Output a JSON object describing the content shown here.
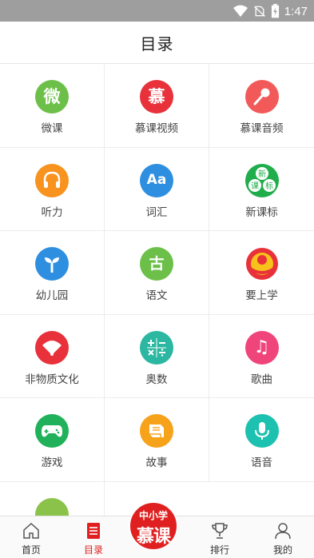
{
  "status_bar": {
    "time": "1:47",
    "icons": [
      "wifi-icon",
      "no-sim-icon",
      "battery-charging-icon"
    ]
  },
  "header": {
    "title": "目录"
  },
  "grid": {
    "items": [
      {
        "label": "微课",
        "icon": "wei-icon",
        "glyph": "微",
        "color": "#6cc04a"
      },
      {
        "label": "慕课视频",
        "icon": "mu-icon",
        "glyph": "慕",
        "color": "#e8313a"
      },
      {
        "label": "慕课音频",
        "icon": "microphone-icon",
        "glyph": "",
        "color": "#f25a5a"
      },
      {
        "label": "听力",
        "icon": "headphones-icon",
        "glyph": "",
        "color": "#f7931e"
      },
      {
        "label": "词汇",
        "icon": "aa-icon",
        "glyph": "Aa",
        "color": "#2e8ee0"
      },
      {
        "label": "新课标",
        "icon": "new-curriculum-icon",
        "glyph": "新",
        "color": "#1fae4b"
      },
      {
        "label": "幼儿园",
        "icon": "sprout-icon",
        "glyph": "",
        "color": "#2e8ee0"
      },
      {
        "label": "语文",
        "icon": "chinese-icon",
        "glyph": "古",
        "color": "#6cc04a"
      },
      {
        "label": "要上学",
        "icon": "school-emblem-icon",
        "glyph": "",
        "color": "#e8313a"
      },
      {
        "label": "非物质文化",
        "icon": "fan-icon",
        "glyph": "",
        "color": "#e8313a"
      },
      {
        "label": "奥数",
        "icon": "math-icon",
        "glyph": "",
        "color": "#2bb7a1"
      },
      {
        "label": "歌曲",
        "icon": "music-note-icon",
        "glyph": "♫",
        "color": "#f0457a"
      },
      {
        "label": "游戏",
        "icon": "gamepad-icon",
        "glyph": "",
        "color": "#20b15a"
      },
      {
        "label": "故事",
        "icon": "book-icon",
        "glyph": "",
        "color": "#f7a21b"
      },
      {
        "label": "语音",
        "icon": "voice-mic-icon",
        "glyph": "",
        "color": "#1cc1b0"
      }
    ]
  },
  "tabbar": {
    "tabs": [
      {
        "label": "首页",
        "icon": "home-icon"
      },
      {
        "label": "目录",
        "icon": "catalog-icon",
        "active": true
      },
      {
        "label": "排行",
        "icon": "trophy-icon"
      },
      {
        "label": "我的",
        "icon": "user-icon"
      }
    ],
    "center_badge": {
      "line1": "中小学",
      "line2": "慕课"
    }
  },
  "colors": {
    "accent": "#e02020",
    "status_bar": "#9e9e9e"
  }
}
